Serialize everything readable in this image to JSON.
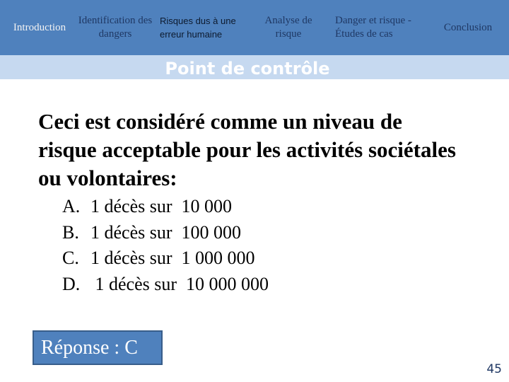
{
  "nav": {
    "items": [
      {
        "label": "Introduction"
      },
      {
        "label": "Identification des dangers"
      },
      {
        "label": "Risques dus à une erreur humaine"
      },
      {
        "label": "Analyse de risque"
      },
      {
        "label": "Danger et risque - Études de cas"
      },
      {
        "label": "Conclusion"
      }
    ]
  },
  "section_title": "Point de contrôle",
  "question": "Ceci est considéré comme un niveau de risque acceptable pour les activités sociétales ou volontaires:",
  "options": [
    {
      "letter": "A.",
      "text": "1 décès sur  10 000"
    },
    {
      "letter": "B.",
      "text": "1 décès sur  100 000"
    },
    {
      "letter": "C.",
      "text": "1 décès sur  1 000 000"
    },
    {
      "letter": "D.",
      "text": " 1 décès sur  10 000 000"
    }
  ],
  "answer": "Réponse : C",
  "page_number": "45",
  "colors": {
    "nav_bg": "#4f81bd",
    "band_bg": "#c6d9f0",
    "nav_text": "#1f3864"
  }
}
